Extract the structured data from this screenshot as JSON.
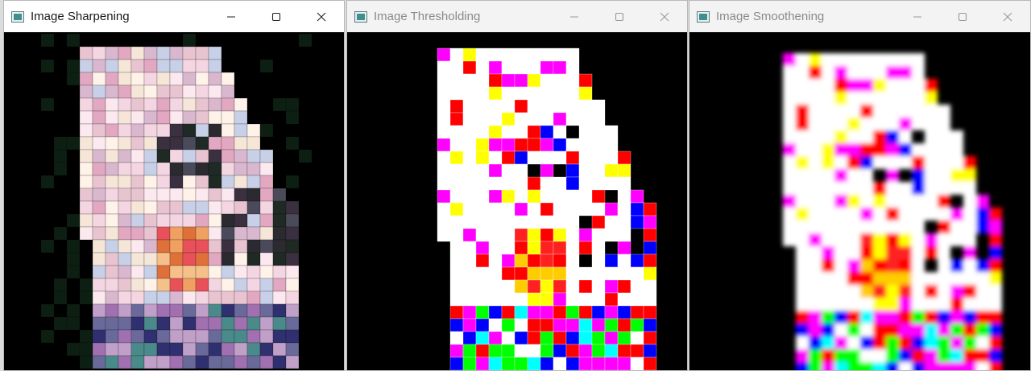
{
  "windows": [
    {
      "title": "Image Sharpening",
      "active": true,
      "mode": "sharpen"
    },
    {
      "title": "Image Thresholding",
      "active": false,
      "mode": "threshold"
    },
    {
      "title": "Image Smoothening",
      "active": false,
      "mode": "smooth"
    }
  ],
  "controls": {
    "minimize": "minimize-icon",
    "maximize": "maximize-icon",
    "close": "close-icon"
  },
  "colors": {
    "titlebar_active": "#ffffff",
    "titlebar_inactive": "#f3f3f3",
    "canvas": "#000000"
  }
}
